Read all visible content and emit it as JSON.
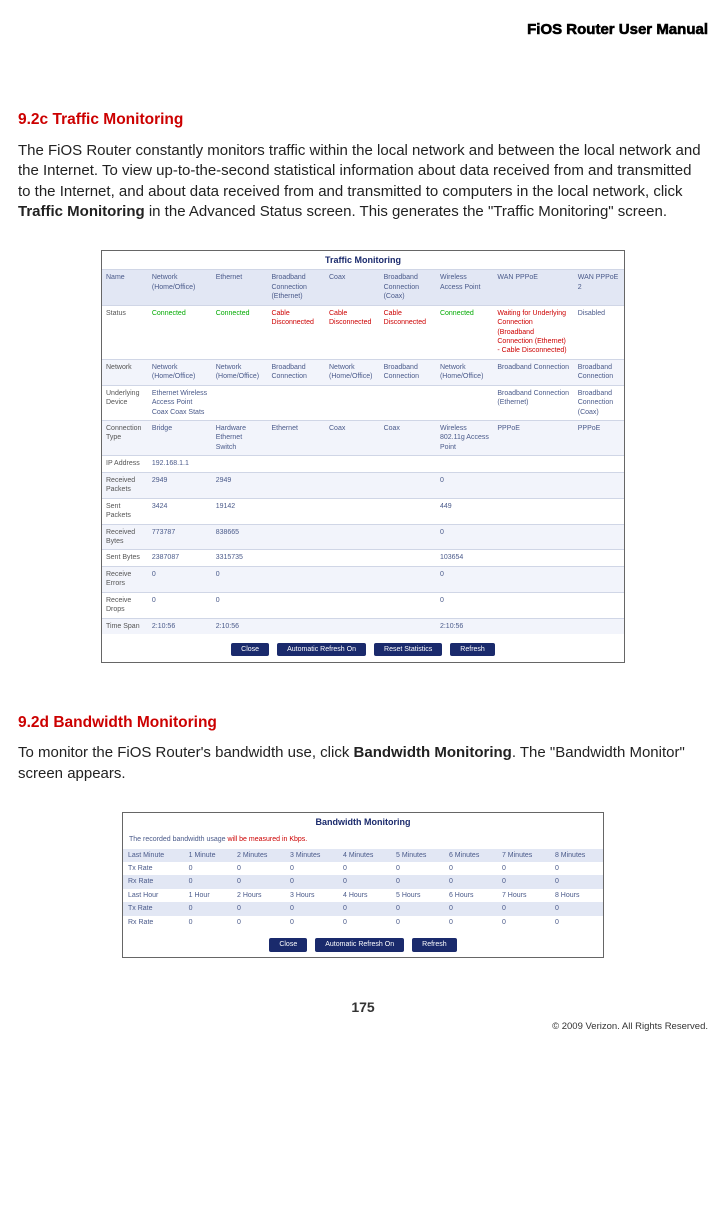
{
  "header": {
    "manual_title": "FiOS Router User Manual"
  },
  "section_92c": {
    "heading": "9.2c  Traffic Monitoring",
    "para_a": "The FiOS Router constantly monitors traffic within the local network and between the local network and the Internet. To view up-to-the-second statistical information about data received from and transmitted to the Internet, and about data received from and transmitted to computers in the local network, click ",
    "para_bold": "Traffic Monitoring",
    "para_b": " in the Advanced Status screen. This generates the \"Traffic Monitoring\" screen."
  },
  "traffic": {
    "title": "Traffic Monitoring",
    "rows": {
      "name": [
        "Name",
        "Network (Home/Office)",
        "Ethernet",
        "Broadband Connection (Ethernet)",
        "Coax",
        "Broadband Connection (Coax)",
        "Wireless Access Point",
        "WAN PPPoE",
        "WAN PPPoE 2"
      ],
      "status": [
        "Status",
        "Connected",
        "Connected",
        "Cable Disconnected",
        "Cable Disconnected",
        "Cable Disconnected",
        "Connected",
        "Waiting for Underlying Connection (Broadband Connection (Ethernet) - Cable Disconnected)",
        "Disabled"
      ],
      "network": [
        "Network",
        "Network (Home/Office)",
        "Network (Home/Office)",
        "Broadband Connection",
        "Network (Home/Office)",
        "Broadband Connection",
        "Network (Home/Office)",
        "Broadband Connection",
        "Broadband Connection"
      ],
      "udev": [
        "Underlying Device",
        "Ethernet Wireless Access Point Coax Coax Stats",
        "",
        "",
        "",
        "",
        "",
        "Broadband Connection (Ethernet)",
        "Broadband Connection (Coax)"
      ],
      "ctype": [
        "Connection Type",
        "Bridge",
        "Hardware Ethernet Switch",
        "Ethernet",
        "Coax",
        "Coax",
        "Wireless 802.11g Access Point",
        "PPPoE",
        "PPPoE"
      ],
      "ip": [
        "IP Address",
        "192.168.1.1",
        "",
        "",
        "",
        "",
        "",
        "",
        ""
      ],
      "rpkt": [
        "Received Packets",
        "2949",
        "2949",
        "",
        "",
        "",
        "0",
        "",
        ""
      ],
      "spkt": [
        "Sent Packets",
        "3424",
        "19142",
        "",
        "",
        "",
        "449",
        "",
        ""
      ],
      "rbytes": [
        "Received Bytes",
        "773787",
        "838665",
        "",
        "",
        "",
        "0",
        "",
        ""
      ],
      "sbytes": [
        "Sent Bytes",
        "2387087",
        "3315735",
        "",
        "",
        "",
        "103654",
        "",
        ""
      ],
      "rerr": [
        "Receive Errors",
        "0",
        "0",
        "",
        "",
        "",
        "0",
        "",
        ""
      ],
      "rdrop": [
        "Receive Drops",
        "0",
        "0",
        "",
        "",
        "",
        "0",
        "",
        ""
      ],
      "tspan": [
        "Time Span",
        "2:10:56",
        "2:10:56",
        "",
        "",
        "",
        "2:10:56",
        "",
        ""
      ]
    },
    "buttons": [
      "Close",
      "Automatic Refresh On",
      "Reset Statistics",
      "Refresh"
    ]
  },
  "section_92d": {
    "heading": "9.2d  Bandwidth Monitoring",
    "para_a": "To monitor the FiOS Router's bandwidth use, click ",
    "para_bold": "Bandwidth Monitoring",
    "para_b": ". The \"Bandwidth Monitor\" screen appears."
  },
  "bandwidth": {
    "title": "Bandwidth Monitoring",
    "note_a": "The recorded bandwidth usage ",
    "note_red": "will be measured in Kbps.",
    "rows": {
      "min_hdr": [
        "Last Minute",
        "1 Minute",
        "2 Minutes",
        "3 Minutes",
        "4 Minutes",
        "5 Minutes",
        "6 Minutes",
        "7 Minutes",
        "8 Minutes"
      ],
      "tx1": [
        "Tx Rate",
        "0",
        "0",
        "0",
        "0",
        "0",
        "0",
        "0",
        "0"
      ],
      "rx1": [
        "Rx Rate",
        "0",
        "0",
        "0",
        "0",
        "0",
        "0",
        "0",
        "0"
      ],
      "hr_hdr": [
        "Last Hour",
        "1 Hour",
        "2 Hours",
        "3 Hours",
        "4 Hours",
        "5 Hours",
        "6 Hours",
        "7 Hours",
        "8 Hours"
      ],
      "tx2": [
        "Tx Rate",
        "0",
        "0",
        "0",
        "0",
        "0",
        "0",
        "0",
        "0"
      ],
      "rx2": [
        "Rx Rate",
        "0",
        "0",
        "0",
        "0",
        "0",
        "0",
        "0",
        "0"
      ]
    },
    "buttons": [
      "Close",
      "Automatic Refresh On",
      "Refresh"
    ]
  },
  "footer": {
    "page": "175",
    "copyright": "© 2009 Verizon. All Rights Reserved."
  }
}
